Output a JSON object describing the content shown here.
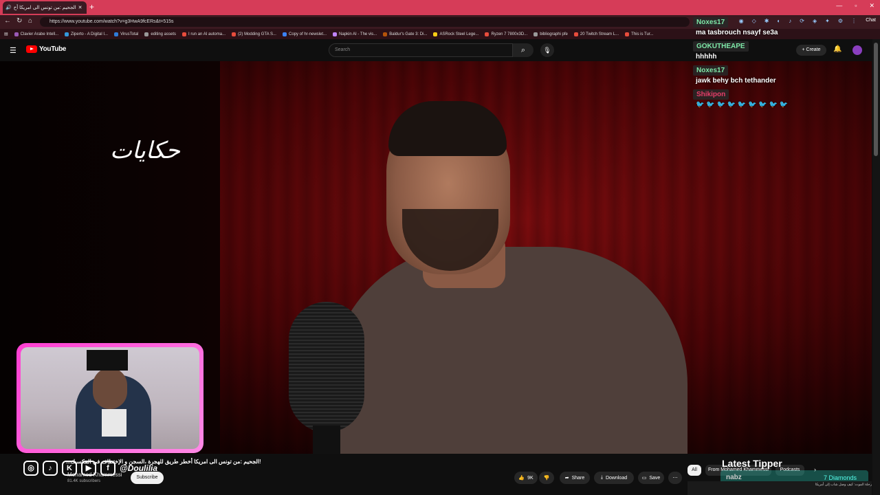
{
  "browser": {
    "tab_title": "الجحيم :من تونس الى امريكا أخ",
    "url": "https://www.youtube.com/watch?v=g3HwA9fcERs&t=515s",
    "chat_label": "Chat",
    "bookmarks": [
      {
        "label": "Clavier Arabe Intell...",
        "color": "#9b59b6"
      },
      {
        "label": "Ziperto - A Digital I...",
        "color": "#3498db"
      },
      {
        "label": "VirusTotal",
        "color": "#2f7bd8"
      },
      {
        "label": "editing assets",
        "color": "#999999"
      },
      {
        "label": "I run an AI automa...",
        "color": "#e74c3c"
      },
      {
        "label": "(2) Modding GTA S...",
        "color": "#e74c3c"
      },
      {
        "label": "Copy of hr-newslet...",
        "color": "#3b82f6"
      },
      {
        "label": "Napkin AI - The vis...",
        "color": "#c084fc"
      },
      {
        "label": "Baldur's Gate 3: Di...",
        "color": "#b45309"
      },
      {
        "label": "ASRock Steel Lege...",
        "color": "#facc15"
      },
      {
        "label": "Ryzen 7 7800x3D...",
        "color": "#e74c3c"
      },
      {
        "label": "bibliographi pfe",
        "color": "#999999"
      },
      {
        "label": "20 Twitch Stream L...",
        "color": "#e74c3c"
      },
      {
        "label": "This is Tur...",
        "color": "#e74c3c"
      }
    ]
  },
  "youtube": {
    "brand": "YouTube",
    "search_placeholder": "Search",
    "create_label": "Create"
  },
  "video": {
    "overlay_logo": "حكايات",
    "title": "!الجحيم :من تونس الى امريكا أخطر طريق للهجرة ،السجن و الإختطاف في المكسيك...",
    "channel": "Mohamed Khammessi",
    "subscribers": "81.4K subscribers",
    "subscribe_label": "Subscribe",
    "likes": "9K",
    "share_label": "Share",
    "download_label": "Download",
    "save_label": "Save"
  },
  "stream_overlay": {
    "social_handle": "@Doulilia",
    "latest_tipper_label": "Latest Tipper",
    "tipper_name": "nabz",
    "tipper_amount": "7 Diamonds"
  },
  "right_panel": {
    "chips": [
      "All",
      "From Mohamed Khammessi",
      "Podcasts"
    ],
    "next_video_text": "رحلة الموت: كيف وصل شاب إلى أمريكا"
  },
  "chat": [
    {
      "name": "Noxes17",
      "color": "#7ee8a8",
      "text": "ma tasbrouch nsayf se3a"
    },
    {
      "name": "GOKUTHEAPE",
      "color": "#7ee8a8",
      "text": "hhhhh"
    },
    {
      "name": "Noxes17",
      "color": "#7ee8a8",
      "text": "jawk behy bch tethander"
    },
    {
      "name": "Shikipon",
      "color": "#e83e6a",
      "text": "🐦 🐦 🐦 🐦 🐦 🐦 🐦 🐦 🐦"
    }
  ]
}
